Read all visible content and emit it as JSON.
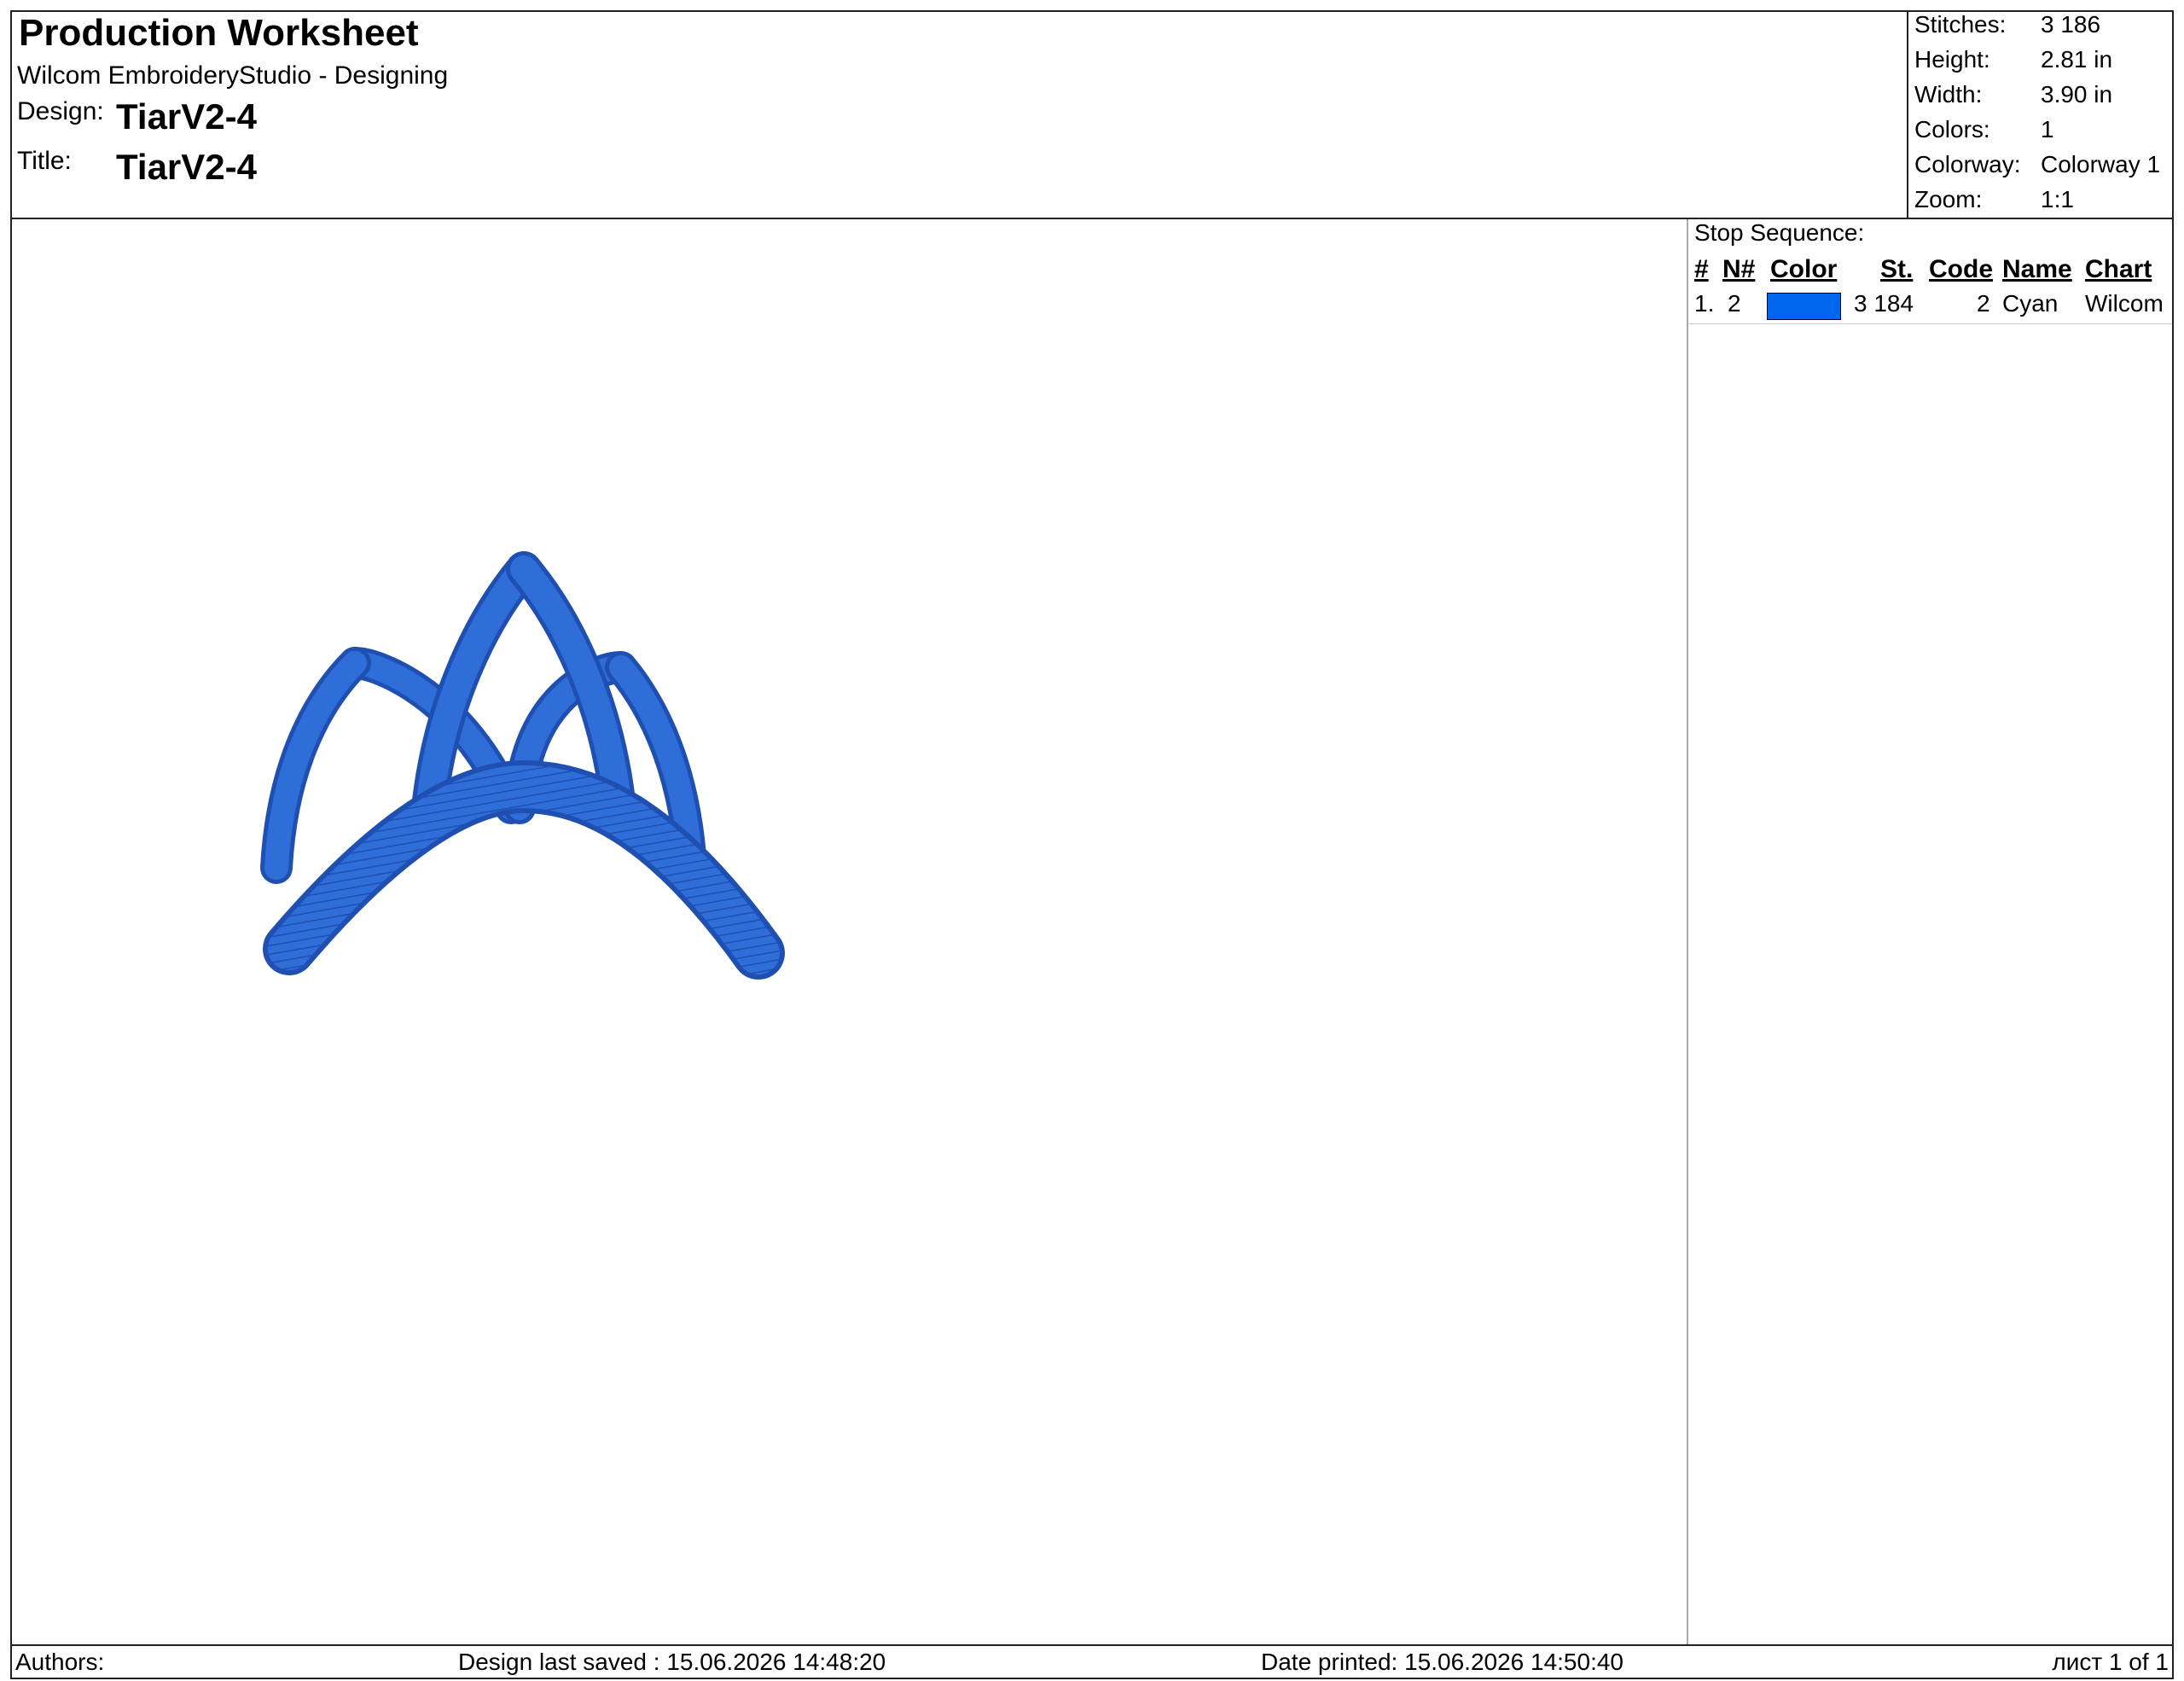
{
  "header": {
    "title": "Production Worksheet",
    "app": "Wilcom EmbroideryStudio - Designing",
    "design_label": "Design:",
    "design_value": "TiarV2-4",
    "title_label": "Title:",
    "title_value": "TiarV2-4"
  },
  "stats": [
    {
      "label": "Stitches:",
      "value": "3 186"
    },
    {
      "label": "Height:",
      "value": "2.81 in"
    },
    {
      "label": "Width:",
      "value": "3.90 in"
    },
    {
      "label": "Colors:",
      "value": "1"
    },
    {
      "label": "Colorway:",
      "value": "Colorway 1"
    },
    {
      "label": "Zoom:",
      "value": "1:1"
    }
  ],
  "stop_sequence": {
    "title": "Stop Sequence:",
    "columns": {
      "num": "#",
      "needle": "N#",
      "color": "Color",
      "stitches": "St.",
      "code": "Code",
      "name": "Name",
      "chart": "Chart"
    },
    "rows": [
      {
        "num": "1.",
        "needle": "2",
        "swatch_color": "#0066ee",
        "stitches": "3 184",
        "code": "2",
        "name": "Cyan",
        "chart": "Wilcom"
      }
    ]
  },
  "design": {
    "thread_color": "#2f6ed8",
    "thread_shade": "#1f4fb0",
    "thread_light": "#5b93ee"
  },
  "footer": {
    "authors": "Authors:",
    "last_saved": "Design last saved : 15.06.2026 14:48:20",
    "printed": "Date printed: 15.06.2026 14:50:40",
    "page": "лист 1 of 1"
  }
}
